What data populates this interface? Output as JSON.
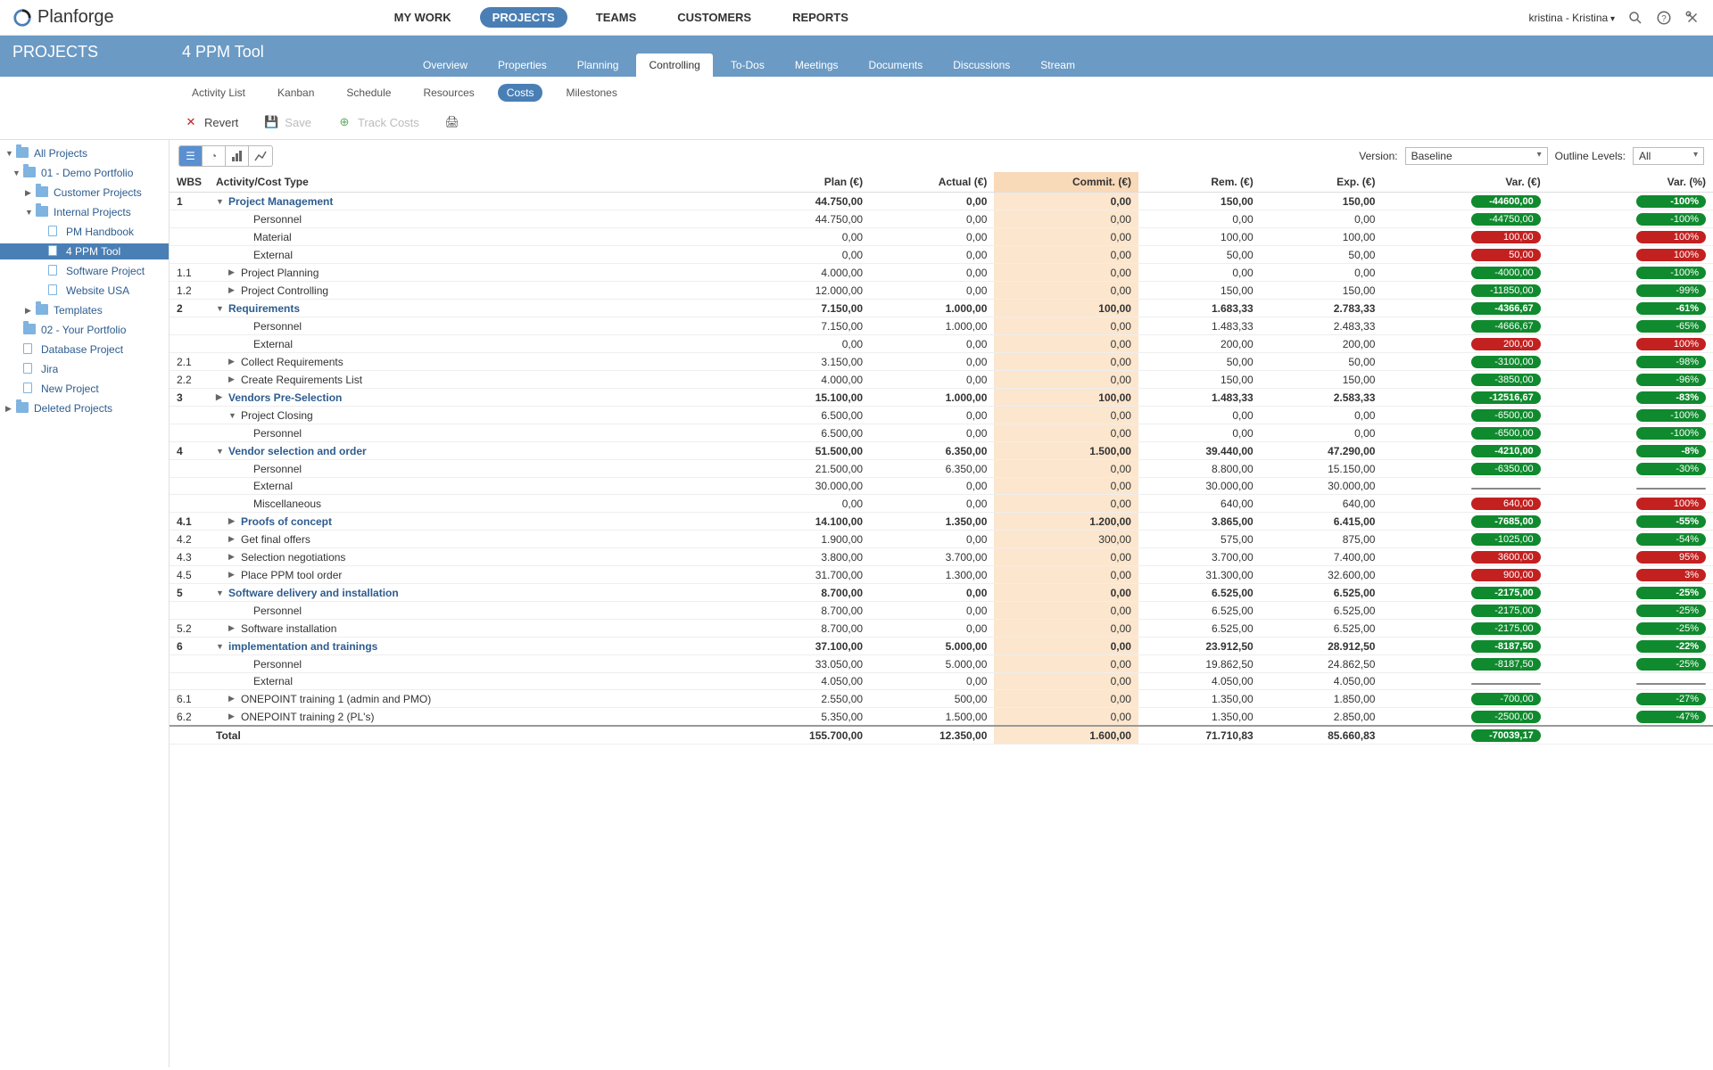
{
  "app": {
    "name": "Planforge"
  },
  "topnav": {
    "mywork": "MY WORK",
    "projects": "PROJECTS",
    "teams": "TEAMS",
    "customers": "CUSTOMERS",
    "reports": "REPORTS"
  },
  "user": "kristina - Kristina",
  "sidebar_title": "PROJECTS",
  "page_title": "4 PPM Tool",
  "tabs": {
    "overview": "Overview",
    "properties": "Properties",
    "planning": "Planning",
    "controlling": "Controlling",
    "todos": "To-Dos",
    "meetings": "Meetings",
    "documents": "Documents",
    "discussions": "Discussions",
    "stream": "Stream"
  },
  "subtabs": {
    "activity_list": "Activity List",
    "kanban": "Kanban",
    "schedule": "Schedule",
    "resources": "Resources",
    "costs": "Costs",
    "milestones": "Milestones"
  },
  "toolbar": {
    "revert": "Revert",
    "save": "Save",
    "track_costs": "Track Costs"
  },
  "controls": {
    "version_label": "Version:",
    "version_value": "Baseline",
    "outline_label": "Outline Levels:",
    "outline_value": "All"
  },
  "tree": {
    "all_projects": "All Projects",
    "demo_portfolio": "01 - Demo Portfolio",
    "customer_projects": "Customer Projects",
    "internal_projects": "Internal Projects",
    "pm_handbook": "PM Handbook",
    "ppm_tool": "4 PPM Tool",
    "software_project": "Software Project",
    "website_usa": "Website USA",
    "templates": "Templates",
    "your_portfolio": "02 - Your Portfolio",
    "database_project": "Database Project",
    "jira": "Jira",
    "new_project": "New Project",
    "deleted_projects": "Deleted Projects"
  },
  "columns": {
    "wbs": "WBS",
    "activity": "Activity/Cost Type",
    "plan": "Plan (€)",
    "actual": "Actual (€)",
    "commit": "Commit. (€)",
    "rem": "Rem. (€)",
    "exp": "Exp. (€)",
    "var": "Var. (€)",
    "varpct": "Var. (%)"
  },
  "rows": [
    {
      "wbs": "1",
      "name": "Project Management",
      "bold": true,
      "arrow": "down",
      "indent": 0,
      "plan": "44.750,00",
      "actual": "0,00",
      "commit": "0,00",
      "rem": "150,00",
      "exp": "150,00",
      "var": "-44600,00",
      "varc": "green",
      "varpct": "-100%",
      "varpctc": "green"
    },
    {
      "wbs": "",
      "name": "Personnel",
      "indent": 2,
      "plan": "44.750,00",
      "actual": "0,00",
      "commit": "0,00",
      "rem": "0,00",
      "exp": "0,00",
      "var": "-44750,00",
      "varc": "green",
      "varpct": "-100%",
      "varpctc": "green"
    },
    {
      "wbs": "",
      "name": "Material",
      "indent": 2,
      "plan": "0,00",
      "actual": "0,00",
      "commit": "0,00",
      "rem": "100,00",
      "exp": "100,00",
      "var": "100,00",
      "varc": "red",
      "varpct": "100%",
      "varpctc": "red"
    },
    {
      "wbs": "",
      "name": "External",
      "indent": 2,
      "plan": "0,00",
      "actual": "0,00",
      "commit": "0,00",
      "rem": "50,00",
      "exp": "50,00",
      "var": "50,00",
      "varc": "red",
      "varpct": "100%",
      "varpctc": "red"
    },
    {
      "wbs": "1.1",
      "name": "Project Planning",
      "arrow": "right",
      "indent": 1,
      "plan": "4.000,00",
      "actual": "0,00",
      "commit": "0,00",
      "rem": "0,00",
      "exp": "0,00",
      "var": "-4000,00",
      "varc": "green",
      "varpct": "-100%",
      "varpctc": "green"
    },
    {
      "wbs": "1.2",
      "name": "Project Controlling",
      "arrow": "right",
      "indent": 1,
      "plan": "12.000,00",
      "actual": "0,00",
      "commit": "0,00",
      "rem": "150,00",
      "exp": "150,00",
      "var": "-11850,00",
      "varc": "green",
      "varpct": "-99%",
      "varpctc": "green"
    },
    {
      "wbs": "2",
      "name": "Requirements",
      "bold": true,
      "arrow": "down",
      "indent": 0,
      "plan": "7.150,00",
      "actual": "1.000,00",
      "commit": "100,00",
      "rem": "1.683,33",
      "exp": "2.783,33",
      "var": "-4366,67",
      "varc": "green",
      "varpct": "-61%",
      "varpctc": "green"
    },
    {
      "wbs": "",
      "name": "Personnel",
      "indent": 2,
      "plan": "7.150,00",
      "actual": "1.000,00",
      "commit": "0,00",
      "rem": "1.483,33",
      "exp": "2.483,33",
      "var": "-4666,67",
      "varc": "green",
      "varpct": "-65%",
      "varpctc": "green"
    },
    {
      "wbs": "",
      "name": "External",
      "indent": 2,
      "plan": "0,00",
      "actual": "0,00",
      "commit": "0,00",
      "rem": "200,00",
      "exp": "200,00",
      "var": "200,00",
      "varc": "red",
      "varpct": "100%",
      "varpctc": "red"
    },
    {
      "wbs": "2.1",
      "name": "Collect Requirements",
      "arrow": "right",
      "indent": 1,
      "plan": "3.150,00",
      "actual": "0,00",
      "commit": "0,00",
      "rem": "50,00",
      "exp": "50,00",
      "var": "-3100,00",
      "varc": "green",
      "varpct": "-98%",
      "varpctc": "green"
    },
    {
      "wbs": "2.2",
      "name": "Create Requirements List",
      "arrow": "right",
      "indent": 1,
      "plan": "4.000,00",
      "actual": "0,00",
      "commit": "0,00",
      "rem": "150,00",
      "exp": "150,00",
      "var": "-3850,00",
      "varc": "green",
      "varpct": "-96%",
      "varpctc": "green"
    },
    {
      "wbs": "3",
      "name": "Vendors Pre-Selection",
      "bold": true,
      "arrow": "right",
      "indent": 0,
      "plan": "15.100,00",
      "actual": "1.000,00",
      "commit": "100,00",
      "rem": "1.483,33",
      "exp": "2.583,33",
      "var": "-12516,67",
      "varc": "green",
      "varpct": "-83%",
      "varpctc": "green"
    },
    {
      "wbs": "",
      "name": "Project Closing",
      "arrow": "down",
      "indent": 1,
      "plan": "6.500,00",
      "actual": "0,00",
      "commit": "0,00",
      "rem": "0,00",
      "exp": "0,00",
      "var": "-6500,00",
      "varc": "green",
      "varpct": "-100%",
      "varpctc": "green"
    },
    {
      "wbs": "",
      "name": "Personnel",
      "indent": 2,
      "plan": "6.500,00",
      "actual": "0,00",
      "commit": "0,00",
      "rem": "0,00",
      "exp": "0,00",
      "var": "-6500,00",
      "varc": "green",
      "varpct": "-100%",
      "varpctc": "green"
    },
    {
      "wbs": "4",
      "name": "Vendor selection and order",
      "bold": true,
      "arrow": "down",
      "indent": 0,
      "plan": "51.500,00",
      "actual": "6.350,00",
      "commit": "1.500,00",
      "rem": "39.440,00",
      "exp": "47.290,00",
      "var": "-4210,00",
      "varc": "green",
      "varpct": "-8%",
      "varpctc": "green"
    },
    {
      "wbs": "",
      "name": "Personnel",
      "indent": 2,
      "plan": "21.500,00",
      "actual": "6.350,00",
      "commit": "0,00",
      "rem": "8.800,00",
      "exp": "15.150,00",
      "var": "-6350,00",
      "varc": "green",
      "varpct": "-30%",
      "varpctc": "green"
    },
    {
      "wbs": "",
      "name": "External",
      "indent": 2,
      "plan": "30.000,00",
      "actual": "0,00",
      "commit": "0,00",
      "rem": "30.000,00",
      "exp": "30.000,00",
      "var": "",
      "varc": "gray",
      "varpct": "",
      "varpctc": "gray"
    },
    {
      "wbs": "",
      "name": "Miscellaneous",
      "indent": 2,
      "plan": "0,00",
      "actual": "0,00",
      "commit": "0,00",
      "rem": "640,00",
      "exp": "640,00",
      "var": "640,00",
      "varc": "red",
      "varpct": "100%",
      "varpctc": "red"
    },
    {
      "wbs": "4.1",
      "name": "Proofs of concept",
      "bold": true,
      "arrow": "right",
      "indent": 1,
      "plan": "14.100,00",
      "actual": "1.350,00",
      "commit": "1.200,00",
      "rem": "3.865,00",
      "exp": "6.415,00",
      "var": "-7685,00",
      "varc": "green",
      "varpct": "-55%",
      "varpctc": "green"
    },
    {
      "wbs": "4.2",
      "name": "Get final offers",
      "arrow": "right",
      "indent": 1,
      "plan": "1.900,00",
      "actual": "0,00",
      "commit": "300,00",
      "rem": "575,00",
      "exp": "875,00",
      "var": "-1025,00",
      "varc": "green",
      "varpct": "-54%",
      "varpctc": "green"
    },
    {
      "wbs": "4.3",
      "name": "Selection negotiations",
      "arrow": "right",
      "indent": 1,
      "plan": "3.800,00",
      "actual": "3.700,00",
      "commit": "0,00",
      "rem": "3.700,00",
      "exp": "7.400,00",
      "var": "3600,00",
      "varc": "red",
      "varpct": "95%",
      "varpctc": "red"
    },
    {
      "wbs": "4.5",
      "name": "Place PPM tool order",
      "arrow": "right",
      "indent": 1,
      "plan": "31.700,00",
      "actual": "1.300,00",
      "commit": "0,00",
      "rem": "31.300,00",
      "exp": "32.600,00",
      "var": "900,00",
      "varc": "red",
      "varpct": "3%",
      "varpctc": "red"
    },
    {
      "wbs": "5",
      "name": "Software delivery and installation",
      "bold": true,
      "arrow": "down",
      "indent": 0,
      "plan": "8.700,00",
      "actual": "0,00",
      "commit": "0,00",
      "rem": "6.525,00",
      "exp": "6.525,00",
      "var": "-2175,00",
      "varc": "green",
      "varpct": "-25%",
      "varpctc": "green"
    },
    {
      "wbs": "",
      "name": "Personnel",
      "indent": 2,
      "plan": "8.700,00",
      "actual": "0,00",
      "commit": "0,00",
      "rem": "6.525,00",
      "exp": "6.525,00",
      "var": "-2175,00",
      "varc": "green",
      "varpct": "-25%",
      "varpctc": "green"
    },
    {
      "wbs": "5.2",
      "name": "Software installation",
      "arrow": "right",
      "indent": 1,
      "plan": "8.700,00",
      "actual": "0,00",
      "commit": "0,00",
      "rem": "6.525,00",
      "exp": "6.525,00",
      "var": "-2175,00",
      "varc": "green",
      "varpct": "-25%",
      "varpctc": "green"
    },
    {
      "wbs": "6",
      "name": "implementation and trainings",
      "bold": true,
      "arrow": "down",
      "indent": 0,
      "plan": "37.100,00",
      "actual": "5.000,00",
      "commit": "0,00",
      "rem": "23.912,50",
      "exp": "28.912,50",
      "var": "-8187,50",
      "varc": "green",
      "varpct": "-22%",
      "varpctc": "green"
    },
    {
      "wbs": "",
      "name": "Personnel",
      "indent": 2,
      "plan": "33.050,00",
      "actual": "5.000,00",
      "commit": "0,00",
      "rem": "19.862,50",
      "exp": "24.862,50",
      "var": "-8187,50",
      "varc": "green",
      "varpct": "-25%",
      "varpctc": "green"
    },
    {
      "wbs": "",
      "name": "External",
      "indent": 2,
      "plan": "4.050,00",
      "actual": "0,00",
      "commit": "0,00",
      "rem": "4.050,00",
      "exp": "4.050,00",
      "var": "",
      "varc": "gray",
      "varpct": "",
      "varpctc": "gray"
    },
    {
      "wbs": "6.1",
      "name": "ONEPOINT training 1 (admin and PMO)",
      "arrow": "right",
      "indent": 1,
      "plan": "2.550,00",
      "actual": "500,00",
      "commit": "0,00",
      "rem": "1.350,00",
      "exp": "1.850,00",
      "var": "-700,00",
      "varc": "green",
      "varpct": "-27%",
      "varpctc": "green"
    },
    {
      "wbs": "6.2",
      "name": "ONEPOINT training 2 (PL's)",
      "arrow": "right",
      "indent": 1,
      "plan": "5.350,00",
      "actual": "1.500,00",
      "commit": "0,00",
      "rem": "1.350,00",
      "exp": "2.850,00",
      "var": "-2500,00",
      "varc": "green",
      "varpct": "-47%",
      "varpctc": "green"
    }
  ],
  "total": {
    "label": "Total",
    "plan": "155.700,00",
    "actual": "12.350,00",
    "commit": "1.600,00",
    "rem": "71.710,83",
    "exp": "85.660,83",
    "var": "-70039,17",
    "varc": "green"
  }
}
